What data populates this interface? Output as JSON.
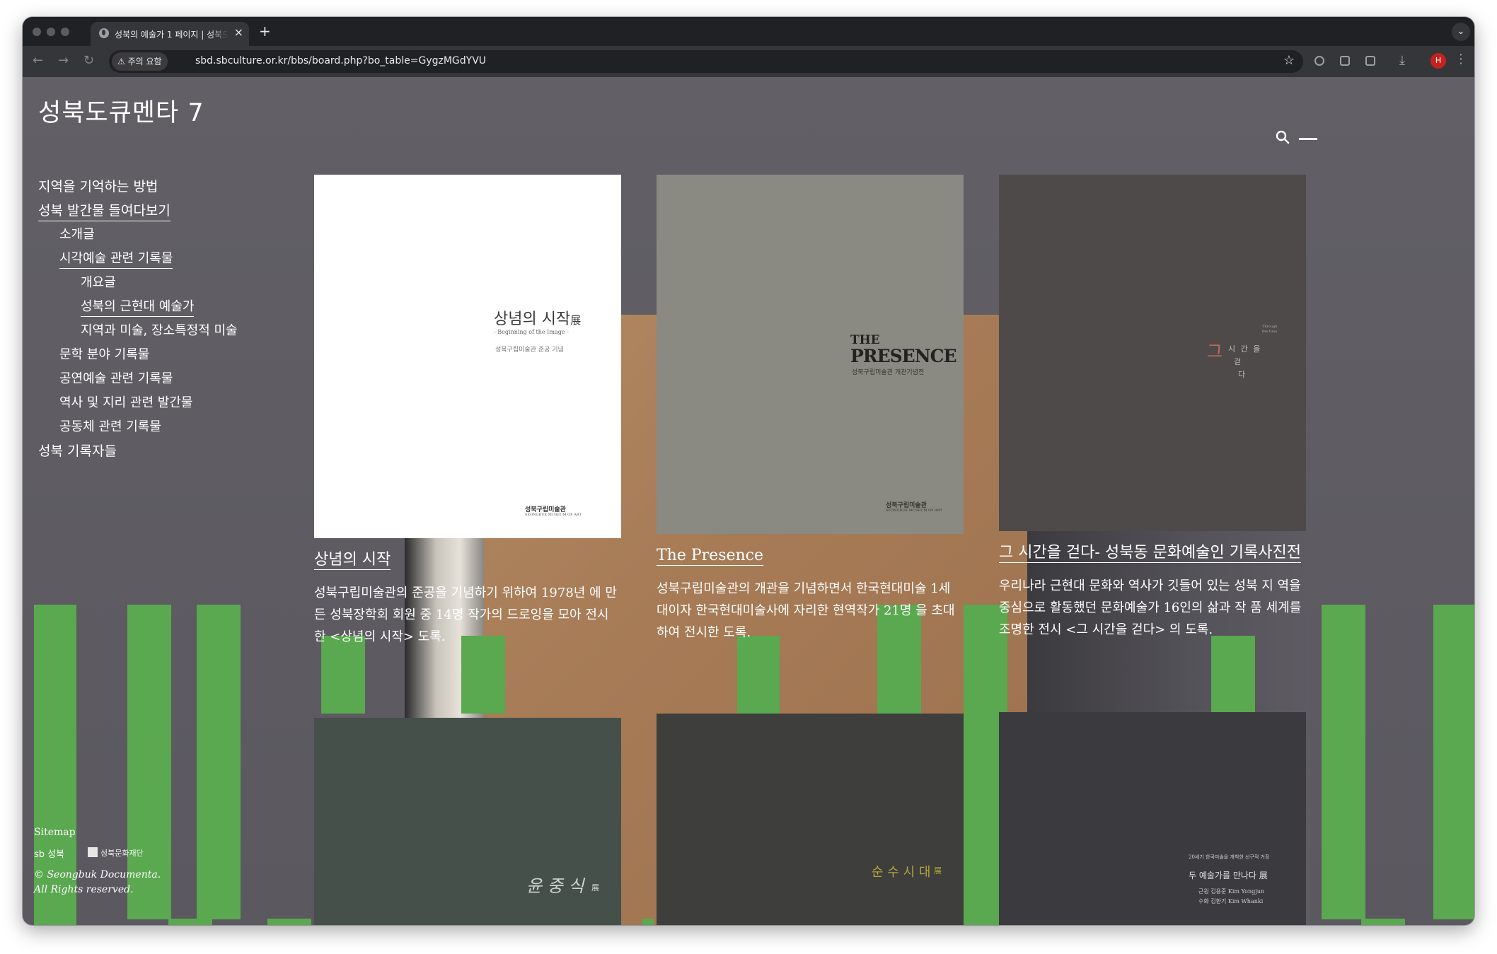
{
  "browser": {
    "tab_title": "성북의 예술가 1 페이지 | 성북도큐멘타",
    "security_chip": "주의 요함",
    "url": "sbd.sbculture.or.kr/bbs/board.php?bo_table=GygzMGdYVU",
    "profile_initial": "H"
  },
  "site": {
    "title": "성북도큐멘타 7"
  },
  "nav": {
    "items": [
      {
        "label": "지역을 기억하는 방법"
      },
      {
        "label": "성북 발간물 들여다보기"
      },
      {
        "label": "소개글"
      },
      {
        "label": "시각예술 관련 기록물"
      },
      {
        "label": "개요글"
      },
      {
        "label": "성북의 근현대 예술가"
      },
      {
        "label": "지역과 미술, 장소특정적 미술"
      },
      {
        "label": "문학 분야 기록물"
      },
      {
        "label": "공연예술 관련 기록물"
      },
      {
        "label": "역사 및 지리 관련 발간물"
      },
      {
        "label": "공동체 관련 기록물"
      },
      {
        "label": "성북 기록자들"
      }
    ]
  },
  "footer": {
    "sitemap": "Sitemap",
    "logo_sb": "sb 성북",
    "logo_foundation": "성북문화재단",
    "copyright_line1": "© Seongbuk Documenta.",
    "copyright_line2": "All Rights reserved."
  },
  "cards": [
    {
      "title": "상념의 시작",
      "description": "성북구립미술관의 준공을 기념하기 위하여 1978년 에 만든 성북장학회 회원 중 14명 작가의 드로잉을 모아 전시한 <상념의 시작> 도록.",
      "cover": {
        "main": "상념의 시작",
        "suffix": "展",
        "sub": "- Beginning of the Image -",
        "caption": "성북구립미술관 준공 기념",
        "publisher": "성북구립미술관",
        "publisher_en": "SEONGBUK MUSEUM OF ART"
      }
    },
    {
      "title": "The Presence",
      "description": "성북구립미술관의 개관을 기념하면서 한국현대미술 1세대이자 한국현대미술사에 자리한 현역작가 21명 을 초대하여 전시한 도록.",
      "cover": {
        "main_top": "THE",
        "main": "PRESENCE",
        "caption": "성북구립미술관 개관기념전",
        "publisher": "성북구립미술관",
        "publisher_en": "SEONGBUK MUSEUM OF ART"
      }
    },
    {
      "title": "그 시간을 걷다- 성북동 문화예술인 기록사진전",
      "description": "우리나라 근현대 문화와 역사가 깃들어 있는 성북 지 역을 중심으로 활동했던 문화예술가 16인의 삶과 작 품 세계를 조명한 전시 <그 시간을 걷다> 의 도록.",
      "cover": {
        "big_char": "그",
        "line1": "시 간 을",
        "line2": "걷",
        "line3": "다",
        "en": "Through the time"
      }
    },
    {
      "cover": {
        "main": "윤 중 식",
        "suffix": "展"
      }
    },
    {
      "cover": {
        "main": "순 수 시 대",
        "suffix": "展"
      }
    },
    {
      "cover": {
        "top": "20세기 한국미술을 개척한 선구적 거장",
        "main": "두 예술가를 만나다 展",
        "line1": "근원 김용준  Kim Yongjun",
        "line2": "수화 김환기  Kim Whanki"
      }
    }
  ],
  "colors": {
    "page_bg": "#5f5c63",
    "accent_green": "#5aa84f",
    "text": "#ffffff"
  }
}
